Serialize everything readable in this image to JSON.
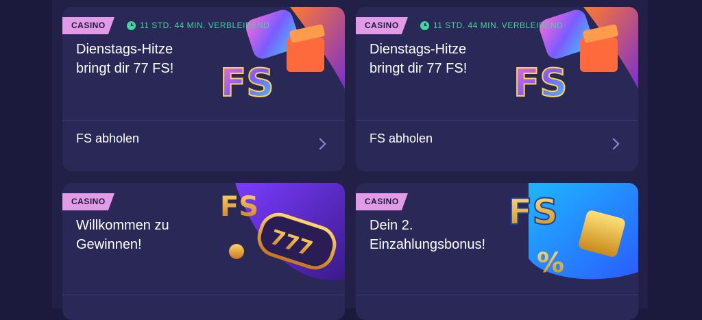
{
  "cards": [
    {
      "badge": "CASINO",
      "timer": "11 STD. 44 MIN. VERBLEIBEND",
      "title": "Dienstags-Hitze\nbringt dir 77 FS!",
      "action": "FS abholen",
      "art_text": "FS"
    },
    {
      "badge": "CASINO",
      "timer": "11 STD. 44 MIN. VERBLEIBEND",
      "title": "Dienstags-Hitze\nbringt dir 77 FS!",
      "action": "FS abholen",
      "art_text": "FS"
    },
    {
      "badge": "CASINO",
      "title": "Willkommen zu\nGewinnen!",
      "art_text": "FS",
      "art_reels": "777"
    },
    {
      "badge": "CASINO",
      "title": "Dein 2.\nEinzahlungsbonus!",
      "art_text": "FS",
      "art_percent": "%"
    }
  ],
  "colors": {
    "background": "#1b1a3d",
    "panel": "#222046",
    "card": "#2a2856",
    "badge": "#e29be6",
    "timer": "#3fd6a0",
    "chevron": "#8f8dd0"
  },
  "icons": {
    "timer": "clock-icon",
    "action": "chevron-right-icon"
  }
}
